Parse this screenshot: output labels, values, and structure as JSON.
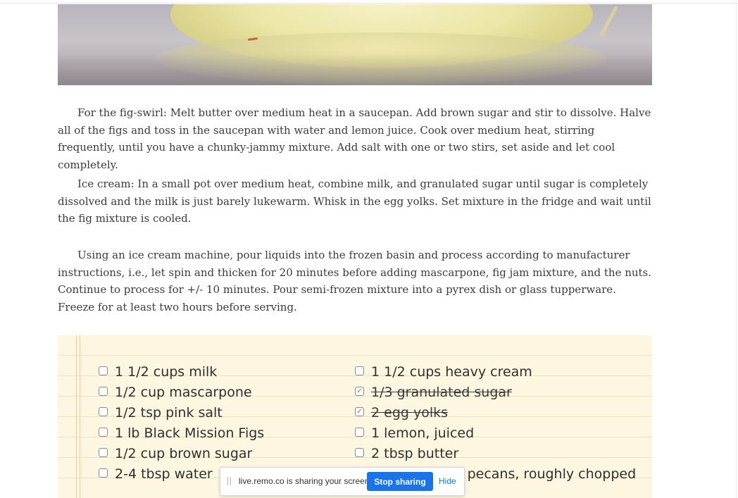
{
  "article": {
    "paragraphs": [
      "For the fig-swirl: Melt butter over medium heat in a saucepan. Add brown sugar and stir to dissolve. Halve all of the figs and toss in the saucepan with water and lemon juice. Cook over medium heat, stirring frequently, until you have a chunky-jammy mixture. Add salt with one or two stirs, set aside and let cool completely.",
      "Ice cream: In a small pot over medium heat, combine milk, and granulated sugar until sugar is completely dissolved and the milk is just barely lukewarm. Whisk in the egg yolks. Set mixture in the fridge and wait until the fig mixture is cooled.",
      "Using an ice cream machine, pour liquids into the frozen basin and process according to manufacturer instructions, i.e., let spin and thicken for 20 minutes before adding mascarpone, fig jam mixture, and the nuts. Continue to process for +/- 10 minutes. Pour semi-frozen mixture into a pyrex dish or glass tupperware. Freeze for at least two hours before serving."
    ]
  },
  "ingredients": {
    "left": [
      {
        "label": "1 1/2 cups milk",
        "checked": false
      },
      {
        "label": "1/2 cup mascarpone",
        "checked": false
      },
      {
        "label": "1/2 tsp pink salt",
        "checked": false
      },
      {
        "label": "1 lb Black Mission Figs",
        "checked": false
      },
      {
        "label": "1/2 cup brown sugar",
        "checked": false
      },
      {
        "label": "2-4 tbsp water",
        "checked": false
      }
    ],
    "right": [
      {
        "label": "1 1/2 cups heavy cream",
        "checked": false
      },
      {
        "label": "1/3 granulated sugar",
        "checked": true
      },
      {
        "label": "2 egg yolks",
        "checked": true
      },
      {
        "label": "1 lemon, juiced",
        "checked": false
      },
      {
        "label": "2 tbsp butter",
        "checked": false
      },
      {
        "label": "1 cup toasted pecans, roughly chopped",
        "checked": false
      }
    ]
  },
  "share_bar": {
    "message": "live.remo.co is sharing your screen.",
    "stop_label": "Stop sharing",
    "hide_label": "Hide"
  },
  "icons": {
    "unchecked": "checkbox-empty-icon",
    "checked": "checkbox-checked-icon",
    "grip": "drag-grip-icon"
  },
  "colors": {
    "card_background": "#fdf6e1",
    "stop_button": "#1a73e8",
    "text": "#3b3b3b"
  }
}
